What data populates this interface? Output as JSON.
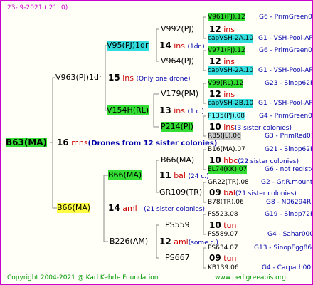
{
  "header": {
    "date": "23-  9-2021  (  21:  0)"
  },
  "footer": {
    "copyright": "Copyright 2004-2021 @ Karl Kehrle Foundation",
    "url": "www.pedigreeapis.org"
  },
  "root": {
    "id": "B63(MA)",
    "num": "16",
    "code": "mns",
    "note": "(Drones from 12 sister colonies)"
  },
  "sire": {
    "id": "V963(PJ)1dr",
    "num": "15",
    "code": "ins",
    "note": "(Only one drone)",
    "a": {
      "id": "V95(PJ)1dr",
      "num": "14",
      "code": "ins",
      "note": "(1dr.)",
      "a": {
        "id": "V992(PJ)",
        "num": "12",
        "code": "ins",
        "top": {
          "id": "V961(PJ).12",
          "info": "G6 - PrimGreen00"
        },
        "bot": {
          "id": "capVSH-2A.10",
          "info": "G1 - VSH-Pool-AR"
        }
      },
      "b": {
        "id": "V964(PJ)",
        "num": "12",
        "code": "ins",
        "top": {
          "id": "V971(PJ).12",
          "info": "G6 - PrimGreen00"
        },
        "bot": {
          "id": "capVSH-2A.10",
          "info": "G1 - VSH-Pool-AR"
        }
      }
    },
    "b": {
      "id": "V154H(RL)",
      "num": "13",
      "code": "ins",
      "note": "(1 c.)",
      "a": {
        "id": "V179(PM)",
        "num": "12",
        "code": "ins",
        "top": {
          "id": "V99(RL).12",
          "info": "G23 - Sinop62R"
        },
        "bot": {
          "id": "capVSH-2B.10",
          "info": "G1 - VSH-Pool-AR"
        }
      },
      "b": {
        "id": "P214(PJ)",
        "num": "10",
        "code": "ins",
        "note": "(3 sister colonies)",
        "top": {
          "id": "P135(PJ).08",
          "info": "G4 - PrimGreen00"
        },
        "bot": {
          "id": "R85(JL).06",
          "info": "G3 - PrimRed01"
        }
      }
    }
  },
  "dam": {
    "id": "B66(MA)",
    "num": "14",
    "code": "aml",
    "note": "(21 sister colonies)",
    "a": {
      "id": "B66(MA)",
      "num": "11",
      "code": "bal",
      "note": "(24 c.)",
      "a": {
        "id": "B66(MA)",
        "num": "10",
        "code": "hbc",
        "note": "(22 sister colonies)",
        "top": {
          "id": "B16(MA).07",
          "info": "G21 - Sinop62R"
        },
        "bot": {
          "id": "EL74(KK).07",
          "info": "G6 - not registe"
        }
      },
      "b": {
        "id": "GR109(TR)",
        "num": "09",
        "code": "bal",
        "note": "(21 sister colonies)",
        "top": {
          "id": "GR22(TR).08",
          "info": "G2 - Gr.R.mounta"
        },
        "bot": {
          "id": "B78(TR).06",
          "info": "G8 - N06294R"
        }
      }
    },
    "b": {
      "id": "B226(AM)",
      "num": "12",
      "code": "aml",
      "note": "(some c.)",
      "a": {
        "id": "PS559",
        "num": "10",
        "code": "tun",
        "top": {
          "id": "PS523.08",
          "info": "G19 - Sinop72R"
        },
        "bot": {
          "id": "PS589.07",
          "info": "G4 - Sahar00Q"
        }
      },
      "b": {
        "id": "PS667",
        "num": "09",
        "code": "tun",
        "top": {
          "id": "PS634.07",
          "info": "G13 - SinopEgg86R"
        },
        "bot": {
          "id": "KB139.06",
          "info": "G4 - Carpath00R"
        }
      }
    }
  }
}
